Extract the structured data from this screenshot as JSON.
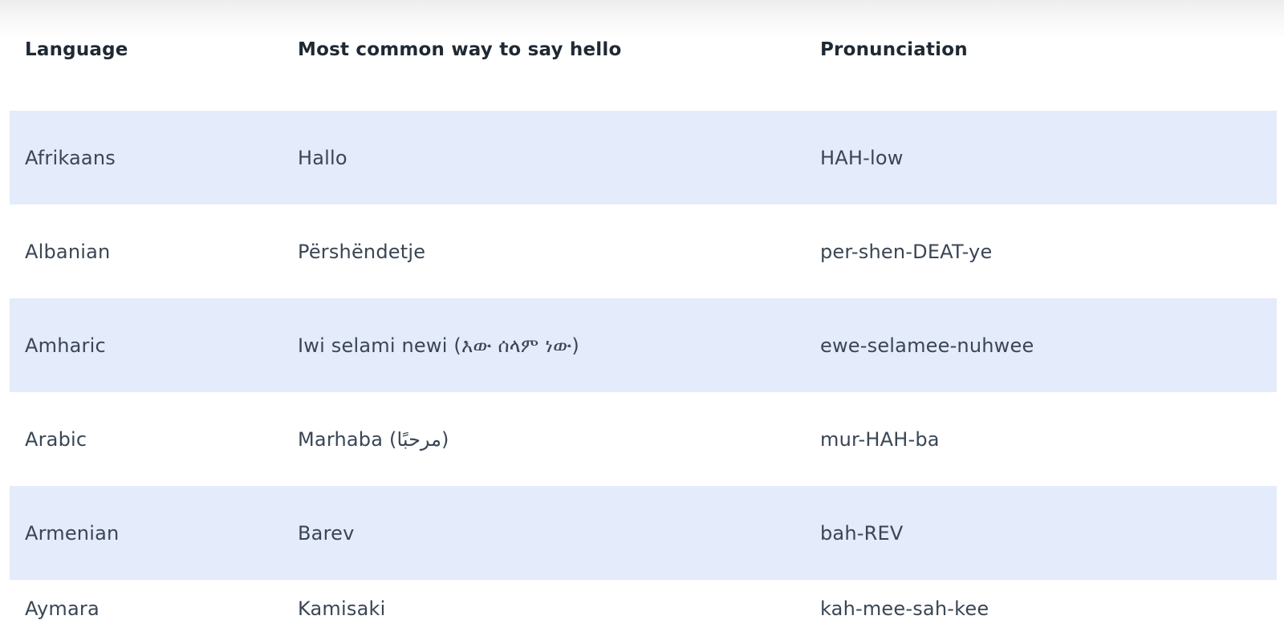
{
  "table": {
    "headers": [
      "Language",
      "Most common way to say hello",
      "Pronunciation"
    ],
    "rows": [
      [
        "Afrikaans",
        "Hallo",
        "HAH-low"
      ],
      [
        "Albanian",
        "Përshëndetje",
        "per-shen-DEAT-ye"
      ],
      [
        "Amharic",
        "Iwi selami newi (እው ሰላም ነው)",
        "ewe-selamee-nuhwee"
      ],
      [
        "Arabic",
        "Marhaba (مرحبًا)",
        "mur-HAH-ba"
      ],
      [
        "Armenian",
        "Barev",
        "bah-REV"
      ],
      [
        "Aymara",
        "Kamisaki",
        "kah-mee-sah-kee"
      ]
    ]
  },
  "colors": {
    "stripe": "#e4ebfa",
    "header_text": "#1f2933",
    "body_text": "#3a4654"
  }
}
